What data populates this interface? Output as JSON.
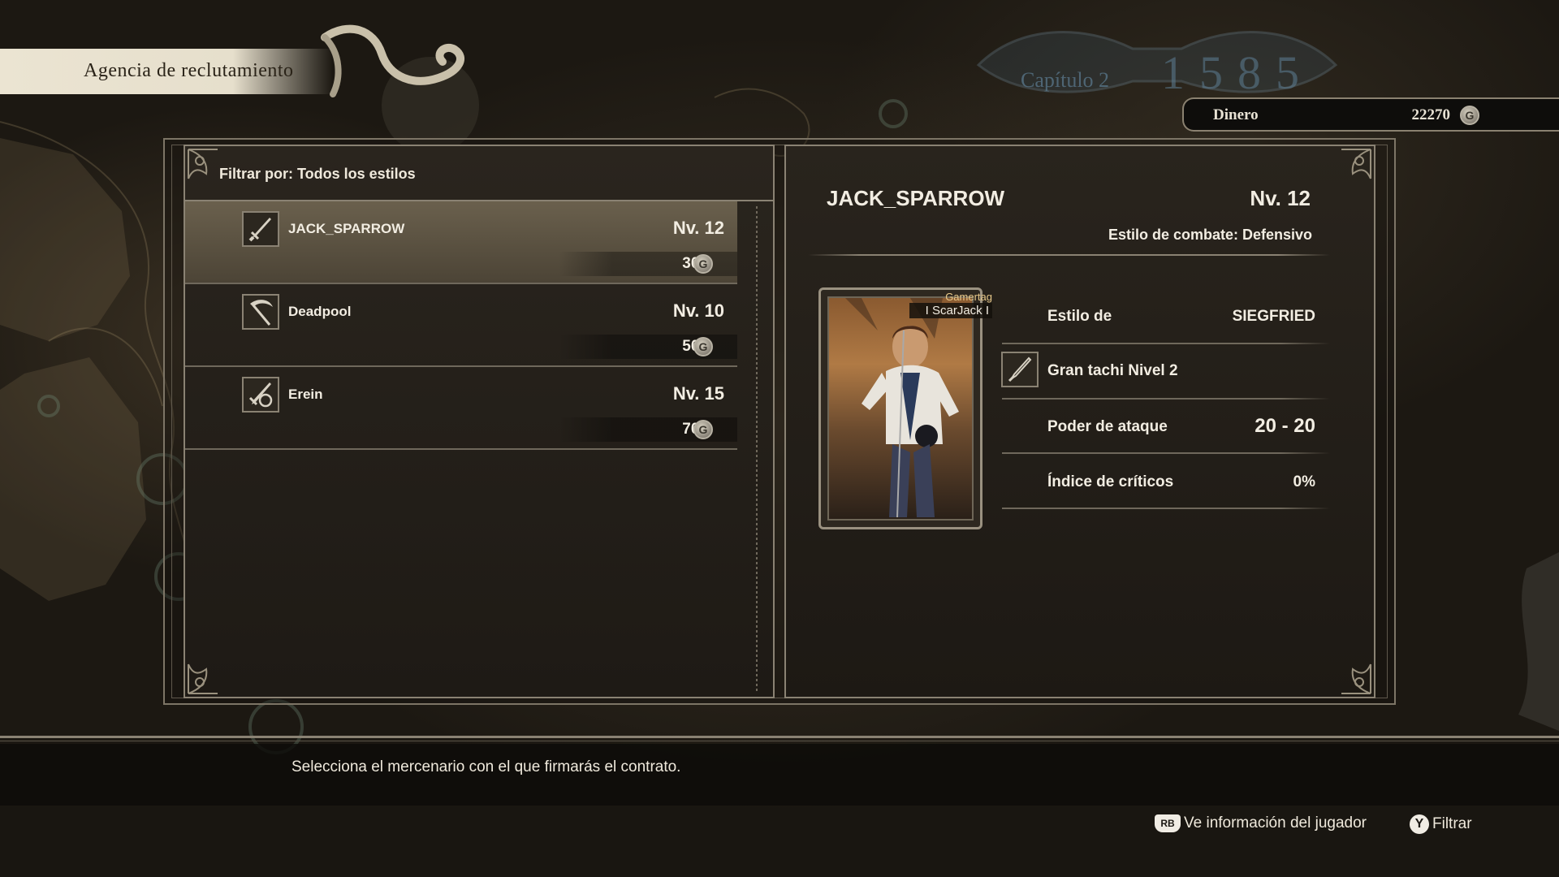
{
  "header": {
    "title": "Agencia de reclutamiento",
    "chapter": "Capítulo 2",
    "year": "1585"
  },
  "money": {
    "label": "Dinero",
    "value": "22270",
    "currency_icon": "gold-coin-icon",
    "currency_symbol": "G"
  },
  "filter": {
    "text": "Filtrar por: Todos los estilos"
  },
  "mercenaries": [
    {
      "name": "JACK_SPARROW",
      "level": "Nv. 12",
      "price": "300",
      "icon": "sword-icon",
      "selected": true
    },
    {
      "name": "Deadpool",
      "level": "Nv. 10",
      "price": "500",
      "icon": "scythe-icon",
      "selected": false
    },
    {
      "name": "Erein",
      "level": "Nv. 15",
      "price": "700",
      "icon": "sword-shield-icon",
      "selected": false
    }
  ],
  "detail": {
    "name": "JACK_SPARROW",
    "level": "Nv. 12",
    "combat_style": "Estilo de combate: Defensivo",
    "gamertag_label": "Gamertag",
    "gamertag_value": "I ScarJack I",
    "style_label": "Estilo de",
    "style_value": "SIEGFRIED",
    "weapon": "Gran tachi Nivel 2",
    "attack_label": "Poder de ataque",
    "attack_value": "20 - 20",
    "crit_label": "Índice de críticos",
    "crit_value": "0%"
  },
  "footer": {
    "hint": "Selecciona el mercenario con el que firmarás el contrato.",
    "action_player_button": "RB",
    "action_player_label": "Ve información del jugador",
    "action_filter_button": "Y",
    "action_filter_label": "Filtrar"
  }
}
